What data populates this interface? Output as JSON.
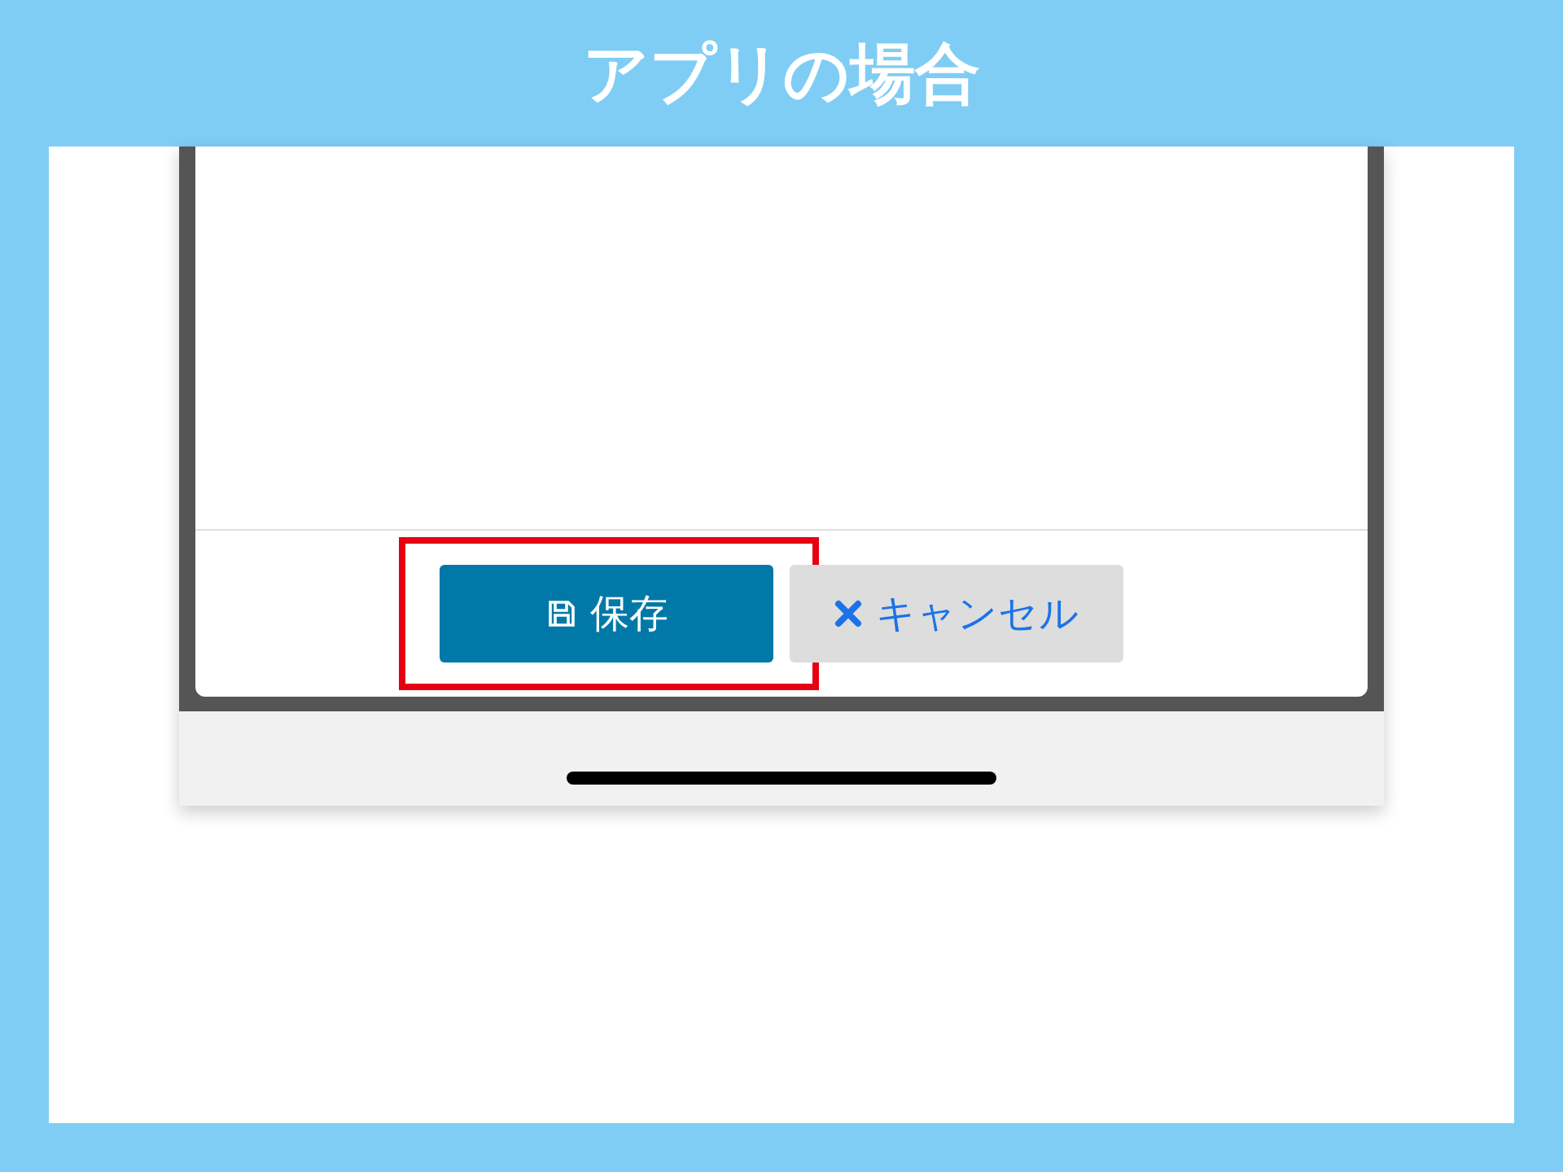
{
  "title": "アプリの場合",
  "buttons": [
    {
      "kind": "save",
      "label": "保存",
      "highlighted": true
    },
    {
      "kind": "cancel",
      "label": "キャンセル",
      "highlighted": false
    }
  ]
}
